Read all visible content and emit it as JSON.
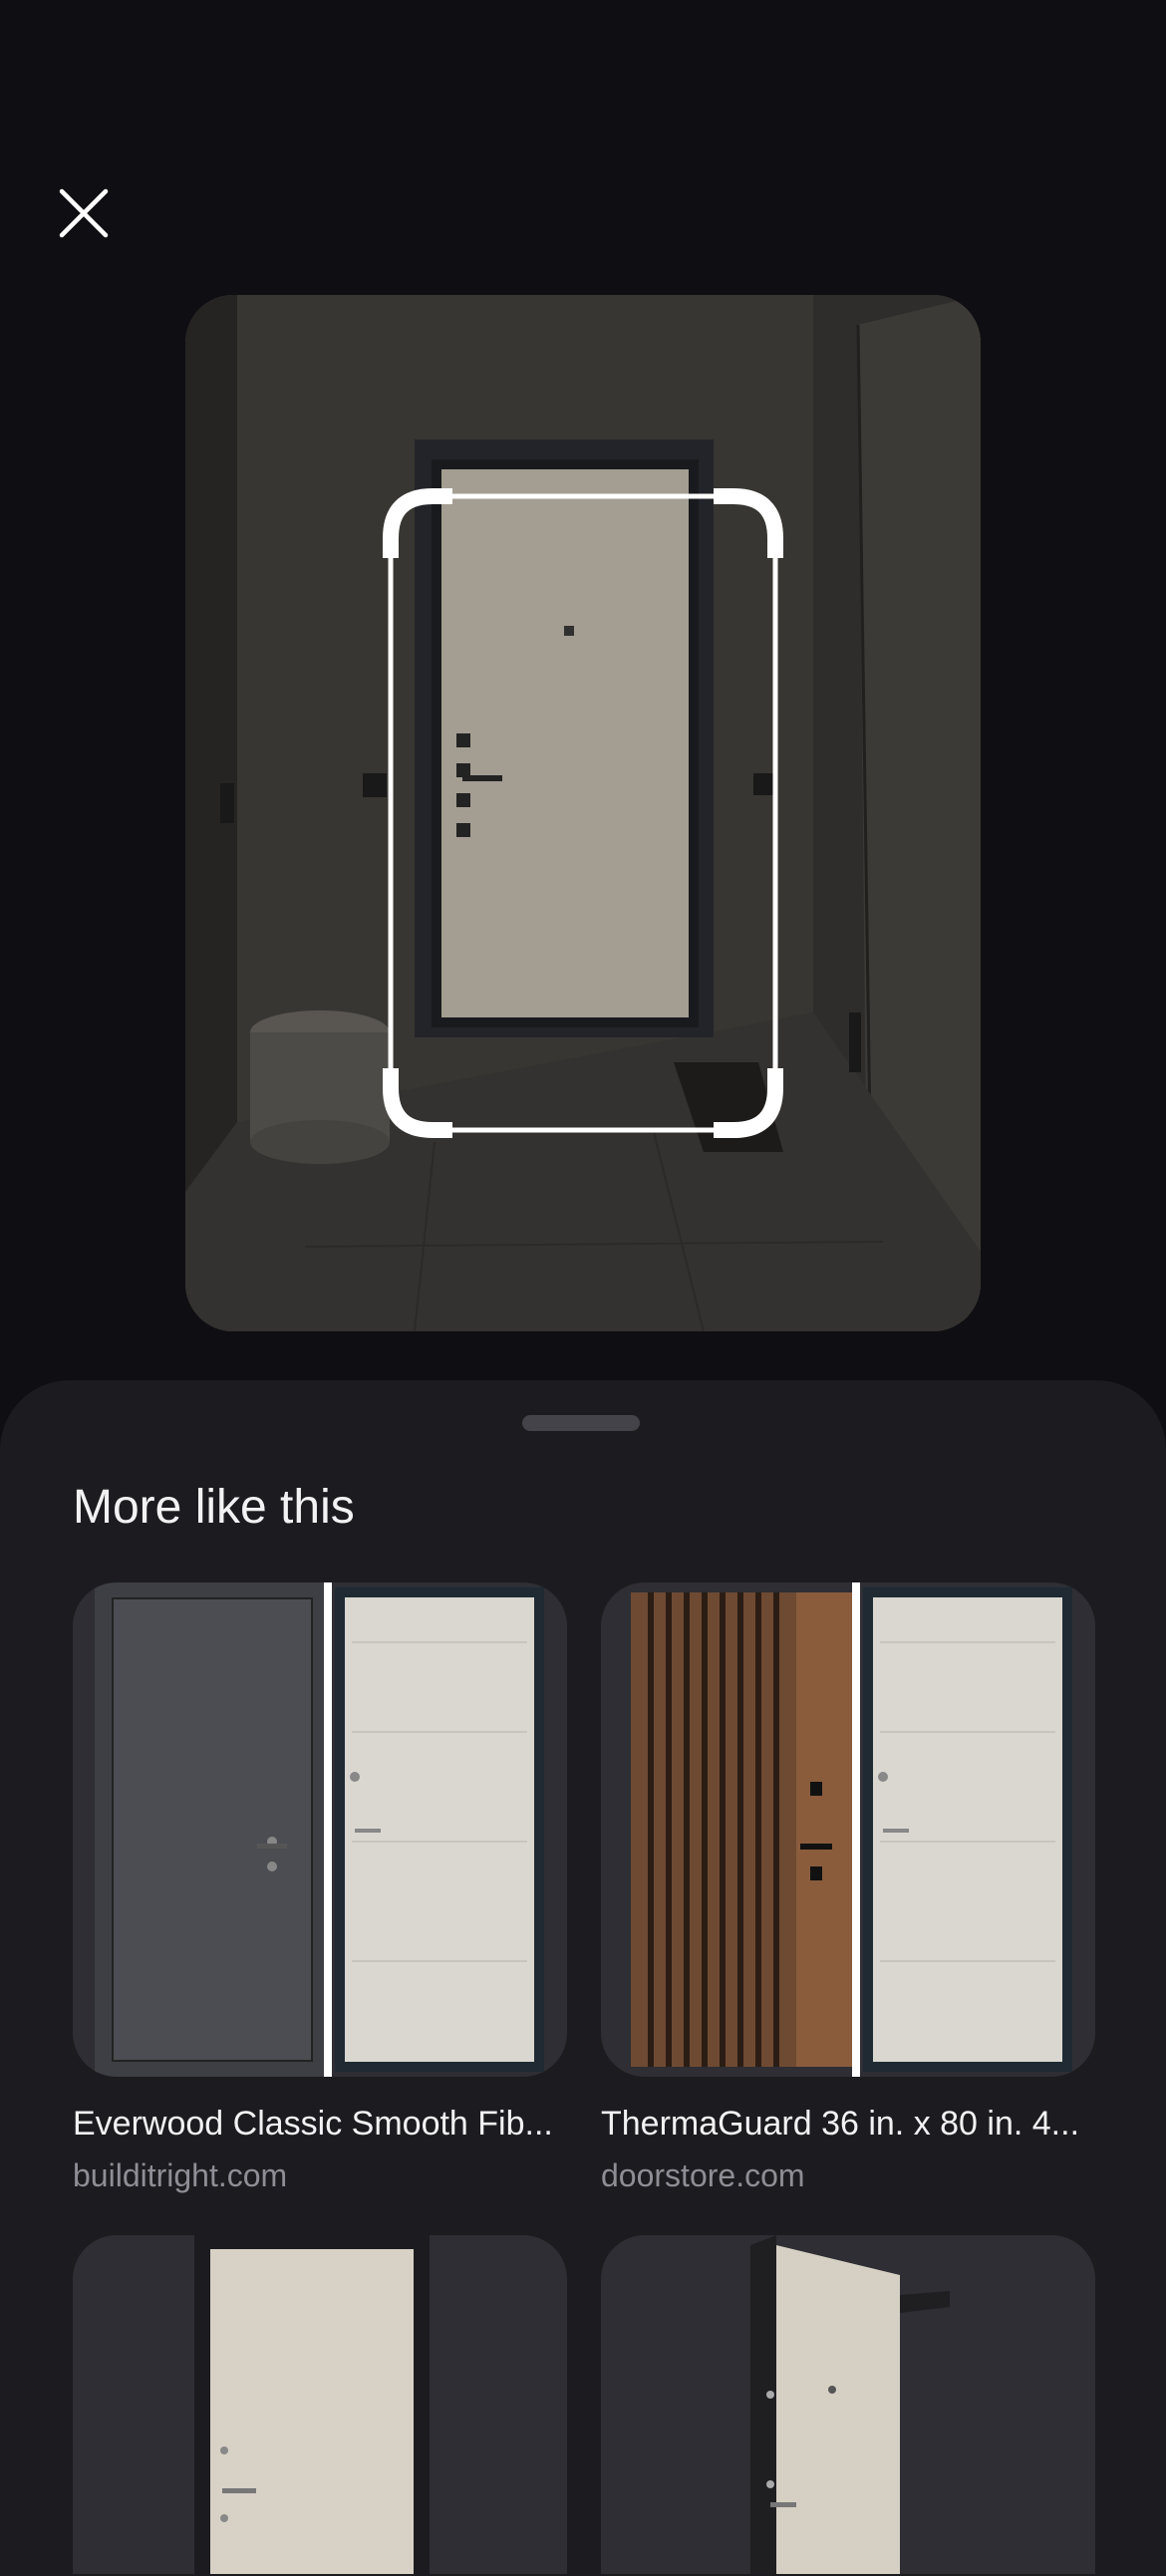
{
  "close": {
    "icon": "close-icon"
  },
  "sheet": {
    "title": "More like this"
  },
  "results": [
    {
      "name": "Everwood Classic Smooth Fib...",
      "source": "builditright.com"
    },
    {
      "name": "ThermaGuard 36 in. x 80 in. 4...",
      "source": "doorstore.com"
    }
  ],
  "colors": {
    "background": "#0f0e12",
    "sheet": "#1c1b1f",
    "secondary_text": "#8f8e96"
  }
}
